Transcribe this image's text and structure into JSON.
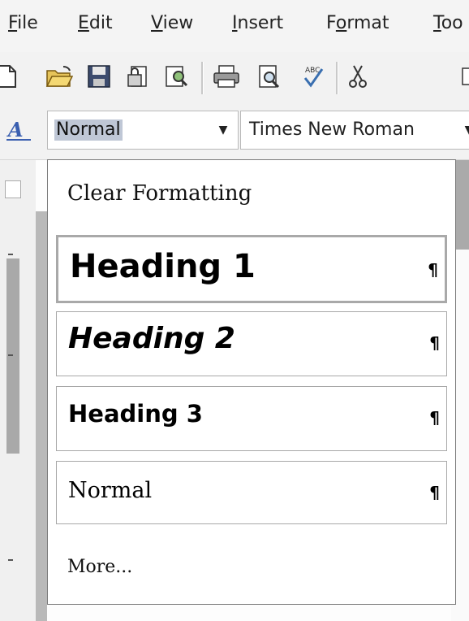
{
  "menubar": {
    "items": [
      {
        "label": "File",
        "underline": "F",
        "rest": "ile"
      },
      {
        "label": "Edit",
        "underline": "E",
        "rest": "dit"
      },
      {
        "label": "View",
        "underline": "V",
        "rest": "iew"
      },
      {
        "label": "Insert",
        "underline": "I",
        "rest": "nsert"
      },
      {
        "label": "Format",
        "pre": "F",
        "underline": "o",
        "rest": "rmat"
      },
      {
        "label": "Too",
        "underline": "T",
        "rest": "oo"
      }
    ]
  },
  "toolbar": {
    "icons": [
      "new-document-icon",
      "open-folder-icon",
      "save-icon",
      "permission-icon",
      "research-icon",
      "print-icon",
      "print-preview-icon",
      "spelling-icon",
      "cut-icon"
    ]
  },
  "formatbar": {
    "style_value": "Normal",
    "font_value": "Times New Roman"
  },
  "dropdown": {
    "clear_formatting": "Clear Formatting",
    "heading1": "Heading 1",
    "heading2": "Heading 2",
    "heading3": "Heading 3",
    "normal": "Normal",
    "more": "More...",
    "pilcrow": "¶"
  },
  "colors": {
    "selection": "#bfc7d6",
    "border": "#a8a8a8",
    "toolbar_bg": "#f2f2f2"
  }
}
